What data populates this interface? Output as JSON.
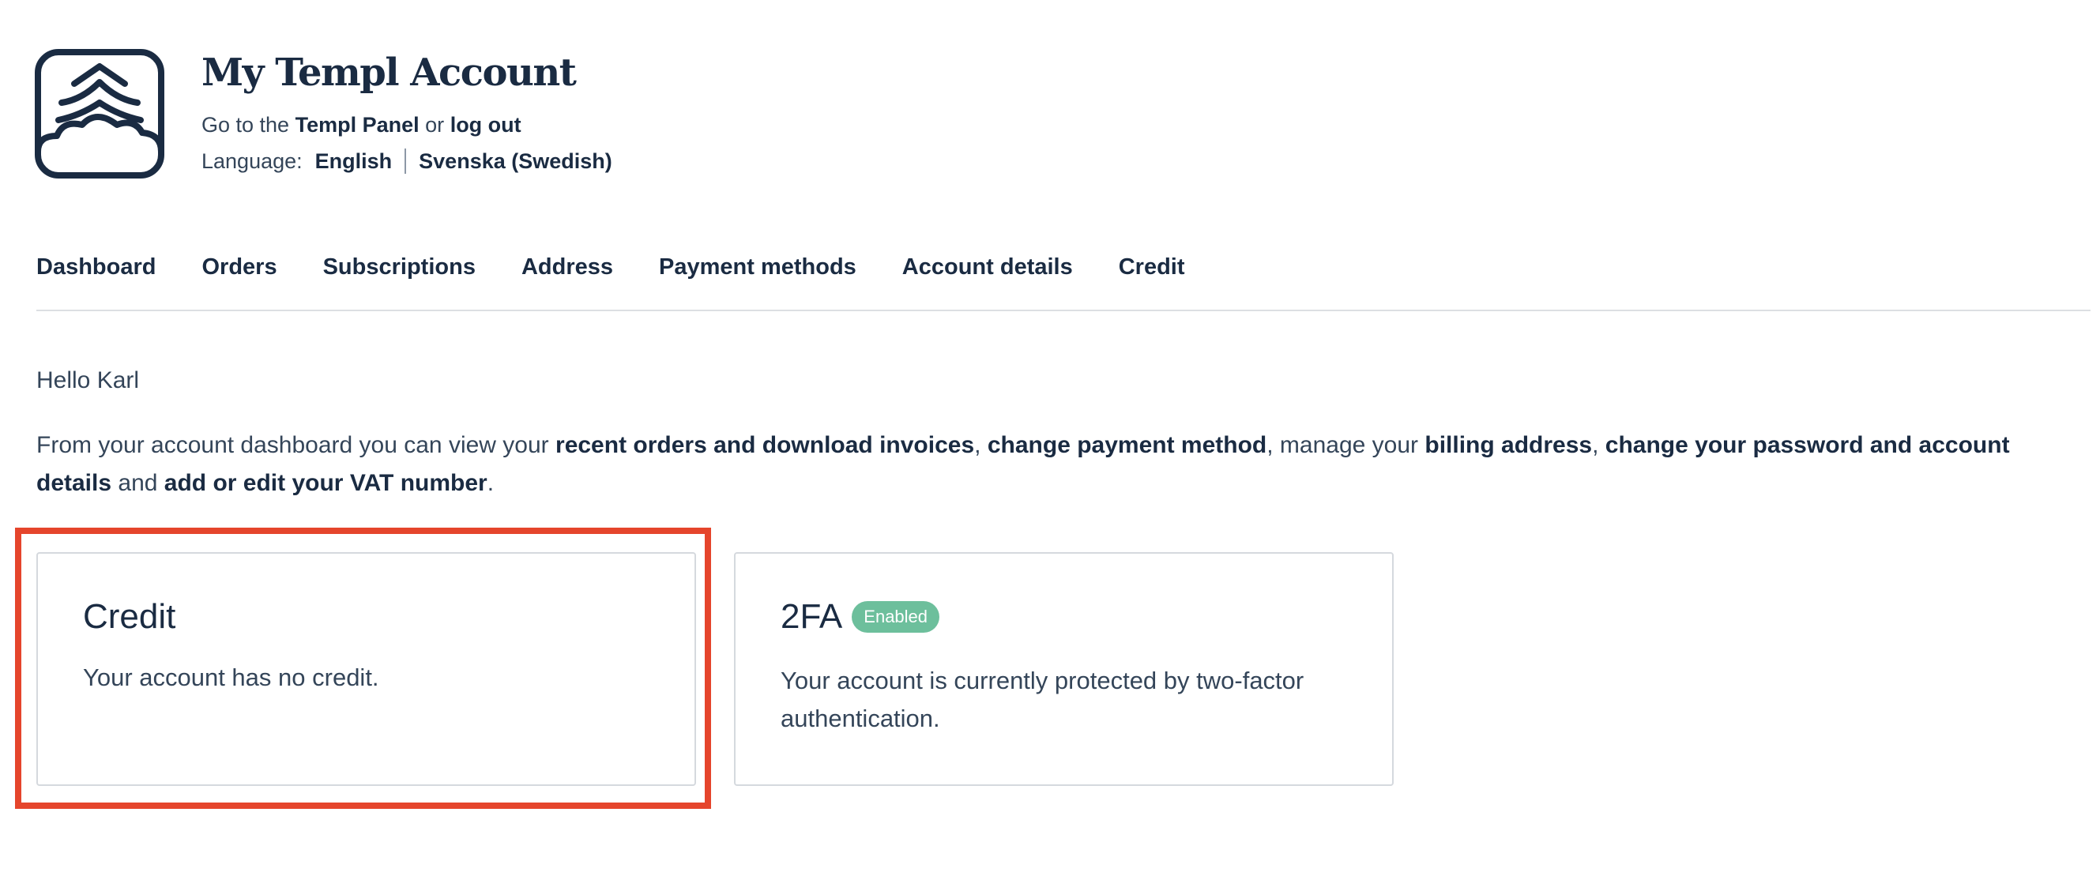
{
  "header": {
    "site_title": "My Templ Account",
    "goto_prefix": "Go to the",
    "panel_link": "Templ Panel",
    "goto_or": "or",
    "logout_link": "log out",
    "language_label": "Language:",
    "languages": [
      "English",
      "Svenska (Swedish)"
    ]
  },
  "nav": {
    "items": [
      "Dashboard",
      "Orders",
      "Subscriptions",
      "Address",
      "Payment methods",
      "Account details",
      "Credit"
    ]
  },
  "main": {
    "greeting": "Hello Karl",
    "intro": {
      "t1": "From your account dashboard you can view your",
      "b1": "recent orders and download invoices",
      "t2": ",",
      "b2": "change payment method",
      "t3": ", manage your",
      "b3": "billing address",
      "t4": ",",
      "b4": "change your password and account details",
      "t5": "and",
      "b5": "add or edit your VAT number",
      "t6": "."
    }
  },
  "cards": {
    "credit": {
      "title": "Credit",
      "text": "Your account has no credit."
    },
    "twofa": {
      "title": "2FA",
      "badge": "Enabled",
      "text": "Your account is currently protected by two-factor authentication."
    }
  },
  "colors": {
    "text_dark": "#1a2b42",
    "text_body": "#344559",
    "badge_green": "#6dbf9c",
    "highlight_red": "#e5452c",
    "border": "#d5d9de"
  },
  "icons": {
    "logo": "templ-cloud-tree-logo"
  }
}
